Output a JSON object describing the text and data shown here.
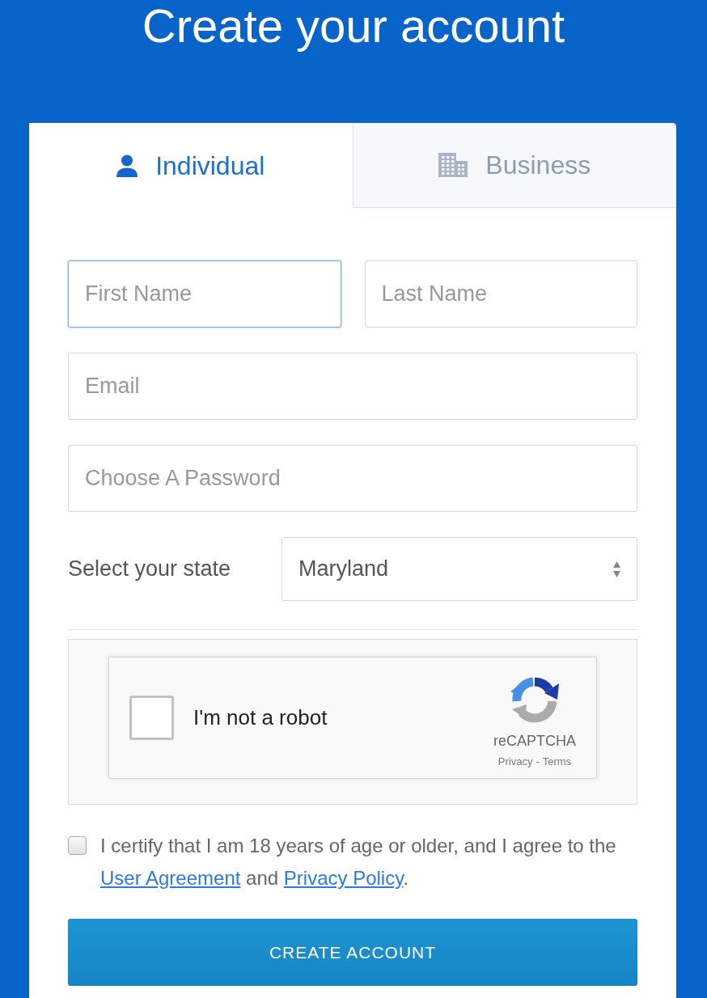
{
  "title": "Create your account",
  "tabs": [
    {
      "label": "Individual",
      "selected": true,
      "kind": "person"
    },
    {
      "label": "Business",
      "selected": false,
      "kind": "building"
    }
  ],
  "name_fields": [
    {
      "placeholder": "First Name",
      "focused": true
    },
    {
      "placeholder": "Last Name",
      "focused": false
    }
  ],
  "email_field": {
    "placeholder": "Email",
    "focused": false
  },
  "password_field": {
    "placeholder": "Choose A Password",
    "focused": false
  },
  "state": {
    "label": "Select your state",
    "value": "Maryland"
  },
  "captcha": {
    "label": "I'm not a robot",
    "checked": false,
    "brand": "reCAPTCHA",
    "links": [
      "Privacy",
      "Terms"
    ],
    "separator": "-"
  },
  "agreement": {
    "checked": false,
    "text": "I certify that I am 18 years of age or older, and I agree to the",
    "links": [
      "User Agreement",
      "Privacy Policy"
    ],
    "joiner": "and",
    "end": "."
  },
  "submit_button": {
    "label": "CREATE ACCOUNT"
  }
}
